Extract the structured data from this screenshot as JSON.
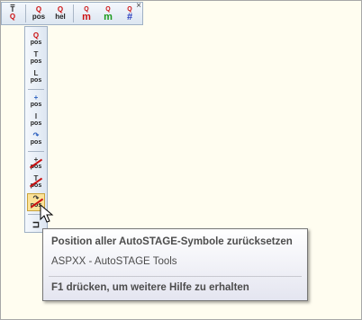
{
  "tooltip": {
    "title": "Position aller AutoSTAGE-Symbole zurücksetzen",
    "subtitle": "ASPXX - AutoSTAGE Tools",
    "help": "F1 drücken, um weitere Hilfe zu erhalten"
  },
  "htoolbar": {
    "buttons": [
      {
        "top": "T",
        "bot": "Q",
        "icon": "text-q-icon"
      },
      {
        "top": "Q",
        "bot": "pos",
        "icon": "q-pos-icon"
      },
      {
        "top": "Q",
        "bot": "hel",
        "icon": "q-hel-icon"
      },
      {
        "top": "m",
        "bot": "Q",
        "icon": "m-q-red-icon"
      },
      {
        "top": "m",
        "bot": "Q",
        "icon": "m-q-green-icon"
      },
      {
        "top": "#",
        "bot": "Q",
        "icon": "hash-q-icon"
      }
    ],
    "close": "×"
  },
  "vtoolbar": {
    "buttons": [
      {
        "glyph": "Q",
        "bot": "pos"
      },
      {
        "glyph": "T",
        "bot": "pos"
      },
      {
        "glyph": "L",
        "bot": "pos"
      },
      {
        "glyph": "+",
        "bot": "pos"
      },
      {
        "glyph": "I",
        "bot": "pos"
      },
      {
        "glyph": "↷",
        "bot": "pos"
      },
      {
        "glyph": "+",
        "bot": "pos"
      },
      {
        "glyph": "T",
        "bot": "pos"
      },
      {
        "glyph": "↷",
        "bot": "pos"
      }
    ],
    "bottom_icon": "⊐"
  },
  "colors": {
    "accent_red": "#cc1010",
    "tooltip_text": "#4c4c4c"
  }
}
